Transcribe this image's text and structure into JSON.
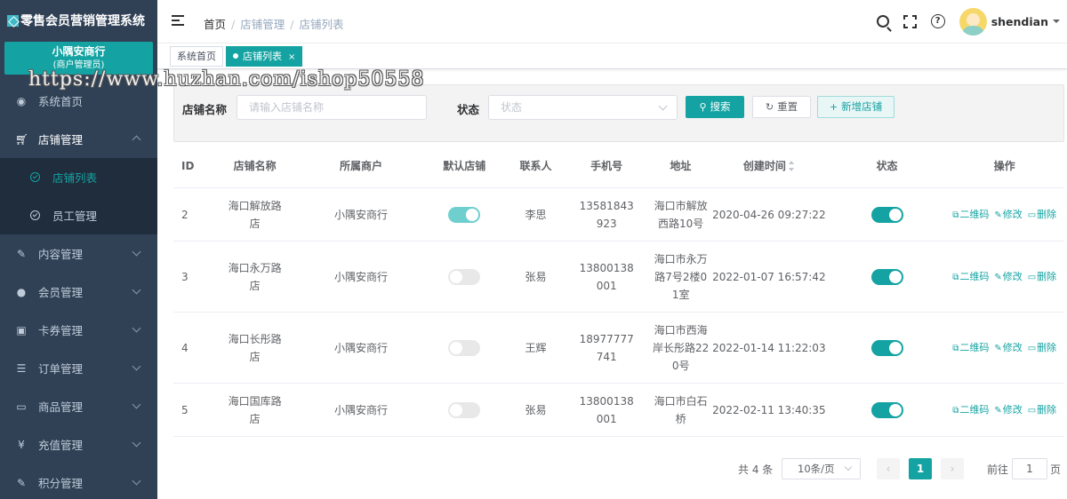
{
  "app": {
    "title": "零售会员营销管理系统"
  },
  "merchant": {
    "name": "小隅安商行",
    "role": "(商户管理员)"
  },
  "sidebar": {
    "items": [
      {
        "label": "系统首页",
        "icon": "dashboard-icon"
      },
      {
        "label": "店铺管理",
        "icon": "cart-icon",
        "expanded": true,
        "children": [
          {
            "label": "店铺列表",
            "active": true
          },
          {
            "label": "员工管理"
          }
        ]
      },
      {
        "label": "内容管理",
        "icon": "edit-icon"
      },
      {
        "label": "会员管理",
        "icon": "users-icon"
      },
      {
        "label": "卡券管理",
        "icon": "ticket-icon"
      },
      {
        "label": "订单管理",
        "icon": "list-icon"
      },
      {
        "label": "商品管理",
        "icon": "monitor-icon"
      },
      {
        "label": "充值管理",
        "icon": "yen-icon"
      },
      {
        "label": "积分管理",
        "icon": "note-icon"
      }
    ]
  },
  "header": {
    "breadcrumb": [
      "首页",
      "店铺管理",
      "店铺列表"
    ],
    "username": "shendian"
  },
  "tags": [
    {
      "label": "系统首页"
    },
    {
      "label": "店铺列表",
      "active": true,
      "close": "×"
    }
  ],
  "search": {
    "name_label": "店铺名称",
    "name_placeholder": "请输入店铺名称",
    "status_label": "状态",
    "status_placeholder": "状态",
    "search_btn": "搜索",
    "reset_btn": "重置",
    "add_btn": "新增店铺"
  },
  "table": {
    "columns": [
      "ID",
      "店铺名称",
      "所属商户",
      "默认店铺",
      "联系人",
      "手机号",
      "地址",
      "创建时间",
      "状态",
      "操作"
    ],
    "op_labels": {
      "qrcode": "二维码",
      "edit": "修改",
      "delete": "删除"
    },
    "rows": [
      {
        "id": "2",
        "name": "海口解放路店",
        "merchant": "小隅安商行",
        "default": true,
        "contact": "李思",
        "phone": "13581843923",
        "address": "海口市解放西路10号",
        "created": "2020-04-26 09:27:22",
        "status": true
      },
      {
        "id": "3",
        "name": "海口永万路店",
        "merchant": "小隅安商行",
        "default": false,
        "contact": "张易",
        "phone": "13800138001",
        "address": "海口市永万路7号2楼01室",
        "created": "2022-01-07 16:57:42",
        "status": true
      },
      {
        "id": "4",
        "name": "海口长彤路店",
        "merchant": "小隅安商行",
        "default": false,
        "contact": "王辉",
        "phone": "18977777741",
        "address": "海口市西海岸长彤路220号",
        "created": "2022-01-14 11:22:03",
        "status": true
      },
      {
        "id": "5",
        "name": "海口国库路店",
        "merchant": "小隅安商行",
        "default": false,
        "contact": "张易",
        "phone": "13800138001",
        "address": "海口市白石桥",
        "created": "2022-02-11 13:40:35",
        "status": true
      }
    ]
  },
  "pagination": {
    "total": "共 4 条",
    "page_size": "10条/页",
    "current": "1",
    "goto_label": "前往",
    "goto_value": "1",
    "page_suffix": "页"
  },
  "watermark": "https://www.huzhan.com/ishop50558",
  "colors": {
    "accent": "#14a3a2",
    "sidebar": "#304156",
    "submenu": "#1f2d3d"
  }
}
